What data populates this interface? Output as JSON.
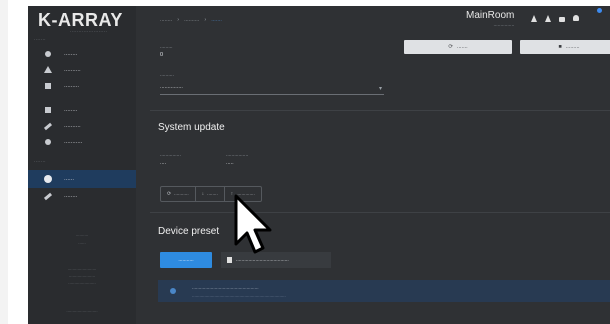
{
  "brand": {
    "logo_text": "K-ARRAY",
    "logo_sub": "......................"
  },
  "sidebar": {
    "section1": ".......",
    "items_top": [
      {
        "label": "........",
        "icon": "dot-icon"
      },
      {
        "label": "..........",
        "icon": "triangle-icon"
      },
      {
        "label": ".........",
        "icon": "square-icon"
      }
    ],
    "items_mid": [
      {
        "label": "........",
        "icon": "speaker-icon"
      },
      {
        "label": "..........",
        "icon": "pen-icon"
      },
      {
        "label": "...........",
        "icon": "puzzle-icon"
      }
    ],
    "section2": ".......",
    "items_bottom": [
      {
        "label": "......",
        "icon": "gear-icon",
        "active": true
      },
      {
        "label": "........",
        "icon": "wrench-icon"
      }
    ],
    "meta1": "..........",
    "meta2": "......",
    "meta3": ".......................",
    "meta4": ".....................",
    "meta5": "......................",
    "footer": "........................."
  },
  "topbar": {
    "crumbs": [
      "........",
      "..........",
      "......."
    ],
    "device_name": "MainRoom",
    "device_ip": "...............",
    "icons": [
      "triangle-icon",
      "triangle-icon",
      "lock-icon",
      "bell-icon"
    ]
  },
  "actions": {
    "reboot": ".......",
    "shutdown": "........."
  },
  "fields": {
    "field1_label": ".........",
    "field1_value": "0",
    "field2_label": "..........",
    "field2_value": "..............."
  },
  "system_update": {
    "title": "System update",
    "current_label": "...............",
    "current_value": "....",
    "available_label": "................",
    "available_value": ".....",
    "buttons": [
      "...........",
      "........",
      ".............."
    ]
  },
  "device_preset": {
    "title": "Device preset",
    "primary": "...........",
    "secondary": "......................................",
    "info_line1": "..................................................",
    "info_line2": "..........................................................................."
  }
}
